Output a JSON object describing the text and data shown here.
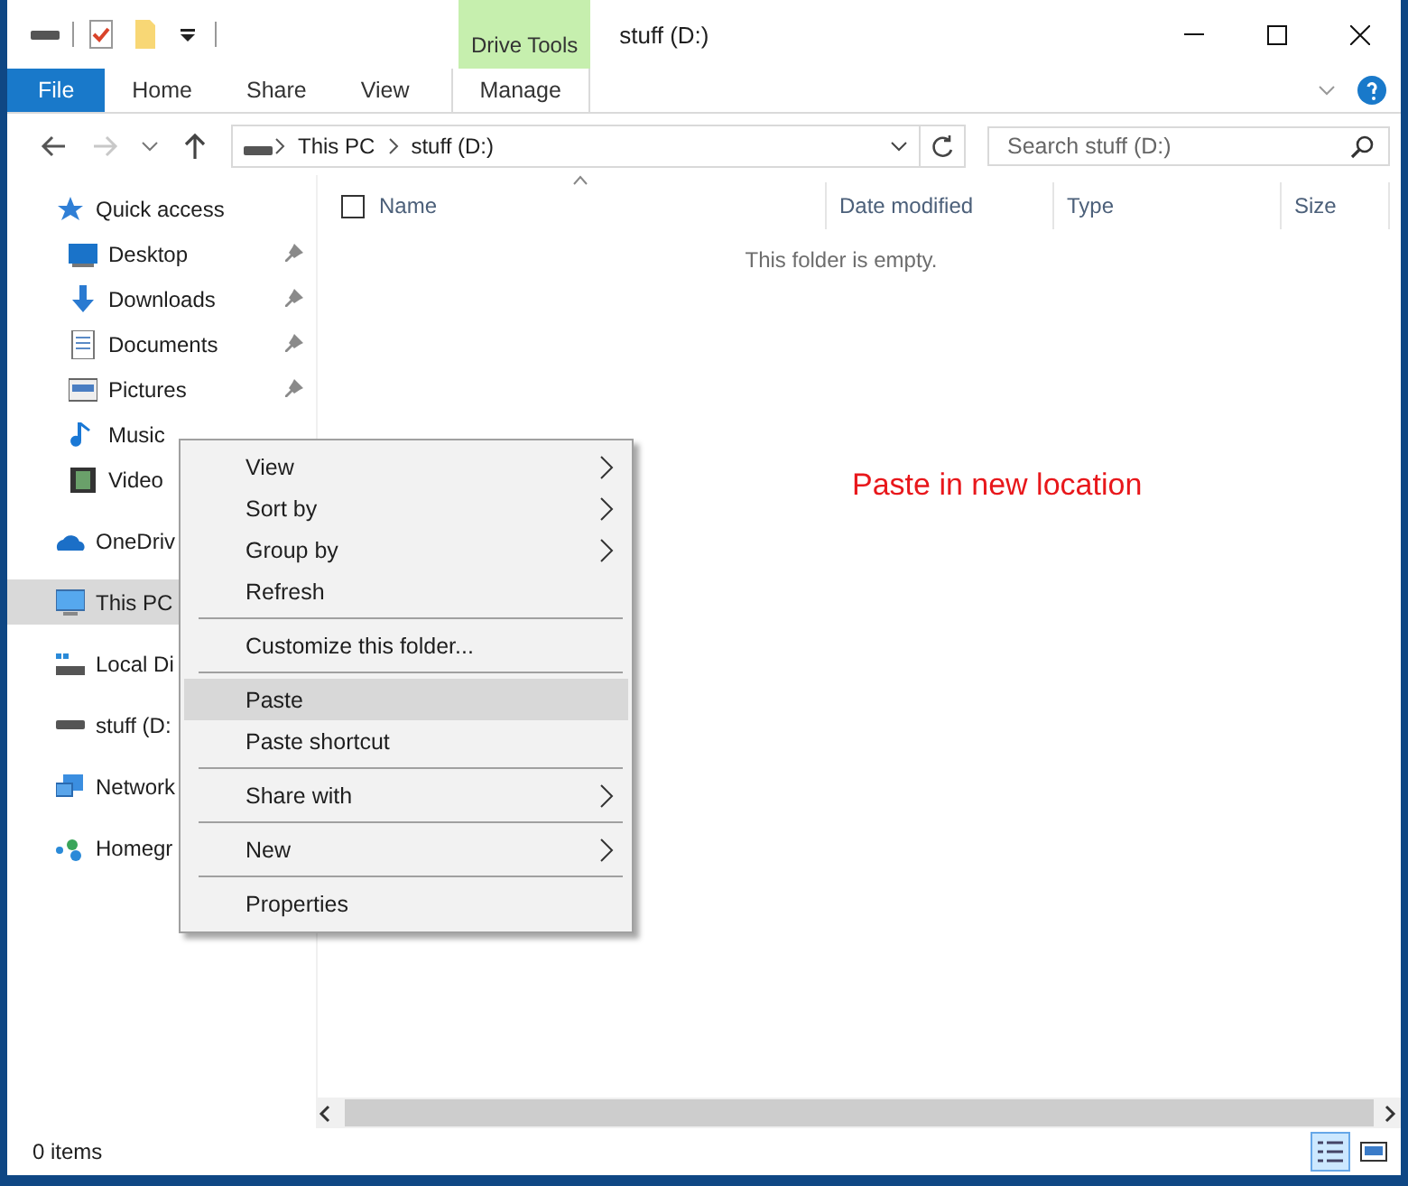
{
  "window": {
    "title": "stuff (D:)"
  },
  "ribbon": {
    "context_group": "Drive Tools",
    "tabs": [
      {
        "label": "File",
        "kind": "file"
      },
      {
        "label": "Home",
        "kind": "tab"
      },
      {
        "label": "Share",
        "kind": "tab"
      },
      {
        "label": "View",
        "kind": "tab"
      },
      {
        "label": "Manage",
        "kind": "context"
      }
    ]
  },
  "address_bar": {
    "path": [
      "This PC",
      "stuff (D:)"
    ],
    "search": {
      "placeholder": "Search stuff (D:)"
    },
    "forward_disabled": true
  },
  "sidebar": [
    {
      "label": "Quick access",
      "kind": "star",
      "selected": false,
      "children": [
        {
          "label": "Desktop",
          "kind": "desktop",
          "pinned": true,
          "selected": false
        },
        {
          "label": "Downloads",
          "kind": "download",
          "pinned": true,
          "selected": false
        },
        {
          "label": "Documents",
          "kind": "document",
          "pinned": true,
          "selected": false
        },
        {
          "label": "Pictures",
          "kind": "pictures",
          "pinned": true,
          "selected": false
        },
        {
          "label": "Music",
          "kind": "music",
          "pinned": false,
          "selected": false
        },
        {
          "label": "Video",
          "kind": "videos",
          "pinned": false,
          "selected": false
        }
      ]
    },
    {
      "label": "OneDriv",
      "kind": "cloud",
      "selected": false
    },
    {
      "label": "This PC",
      "kind": "pc",
      "selected": true
    },
    {
      "label": "Local Di",
      "kind": "localdisk",
      "selected": false
    },
    {
      "label": "stuff (D:",
      "kind": "drive",
      "selected": false
    },
    {
      "label": "Network",
      "kind": "network",
      "selected": false
    },
    {
      "label": "Homegr",
      "kind": "homegroup",
      "selected": false
    }
  ],
  "table": {
    "select_all_checked": false,
    "columns": [
      {
        "label": "Name",
        "sorted": true
      },
      {
        "label": "Date modified",
        "sorted": false
      },
      {
        "label": "Type",
        "sorted": false
      },
      {
        "label": "Size",
        "sorted": false
      }
    ],
    "empty_message": "This folder is empty."
  },
  "annotation": "Paste in new location",
  "context_menu": [
    {
      "kind": "item",
      "label": "View",
      "submenu": true,
      "selected": false
    },
    {
      "kind": "item",
      "label": "Sort by",
      "submenu": true,
      "selected": false
    },
    {
      "kind": "item",
      "label": "Group by",
      "submenu": true,
      "selected": false
    },
    {
      "kind": "item",
      "label": "Refresh",
      "submenu": false,
      "selected": false
    },
    {
      "kind": "separator"
    },
    {
      "kind": "item",
      "label": "Customize this folder...",
      "submenu": false,
      "selected": false
    },
    {
      "kind": "separator"
    },
    {
      "kind": "item",
      "label": "Paste",
      "submenu": false,
      "selected": true
    },
    {
      "kind": "item",
      "label": "Paste shortcut",
      "submenu": false,
      "selected": false
    },
    {
      "kind": "separator"
    },
    {
      "kind": "item",
      "label": "Share with",
      "submenu": true,
      "selected": false
    },
    {
      "kind": "separator"
    },
    {
      "kind": "item",
      "label": "New",
      "submenu": true,
      "selected": false
    },
    {
      "kind": "separator"
    },
    {
      "kind": "item",
      "label": "Properties",
      "submenu": false,
      "selected": false
    }
  ],
  "status_bar": {
    "text": "0 items",
    "views": [
      {
        "kind": "details",
        "selected": true
      },
      {
        "kind": "thumbnails",
        "selected": false
      }
    ]
  }
}
